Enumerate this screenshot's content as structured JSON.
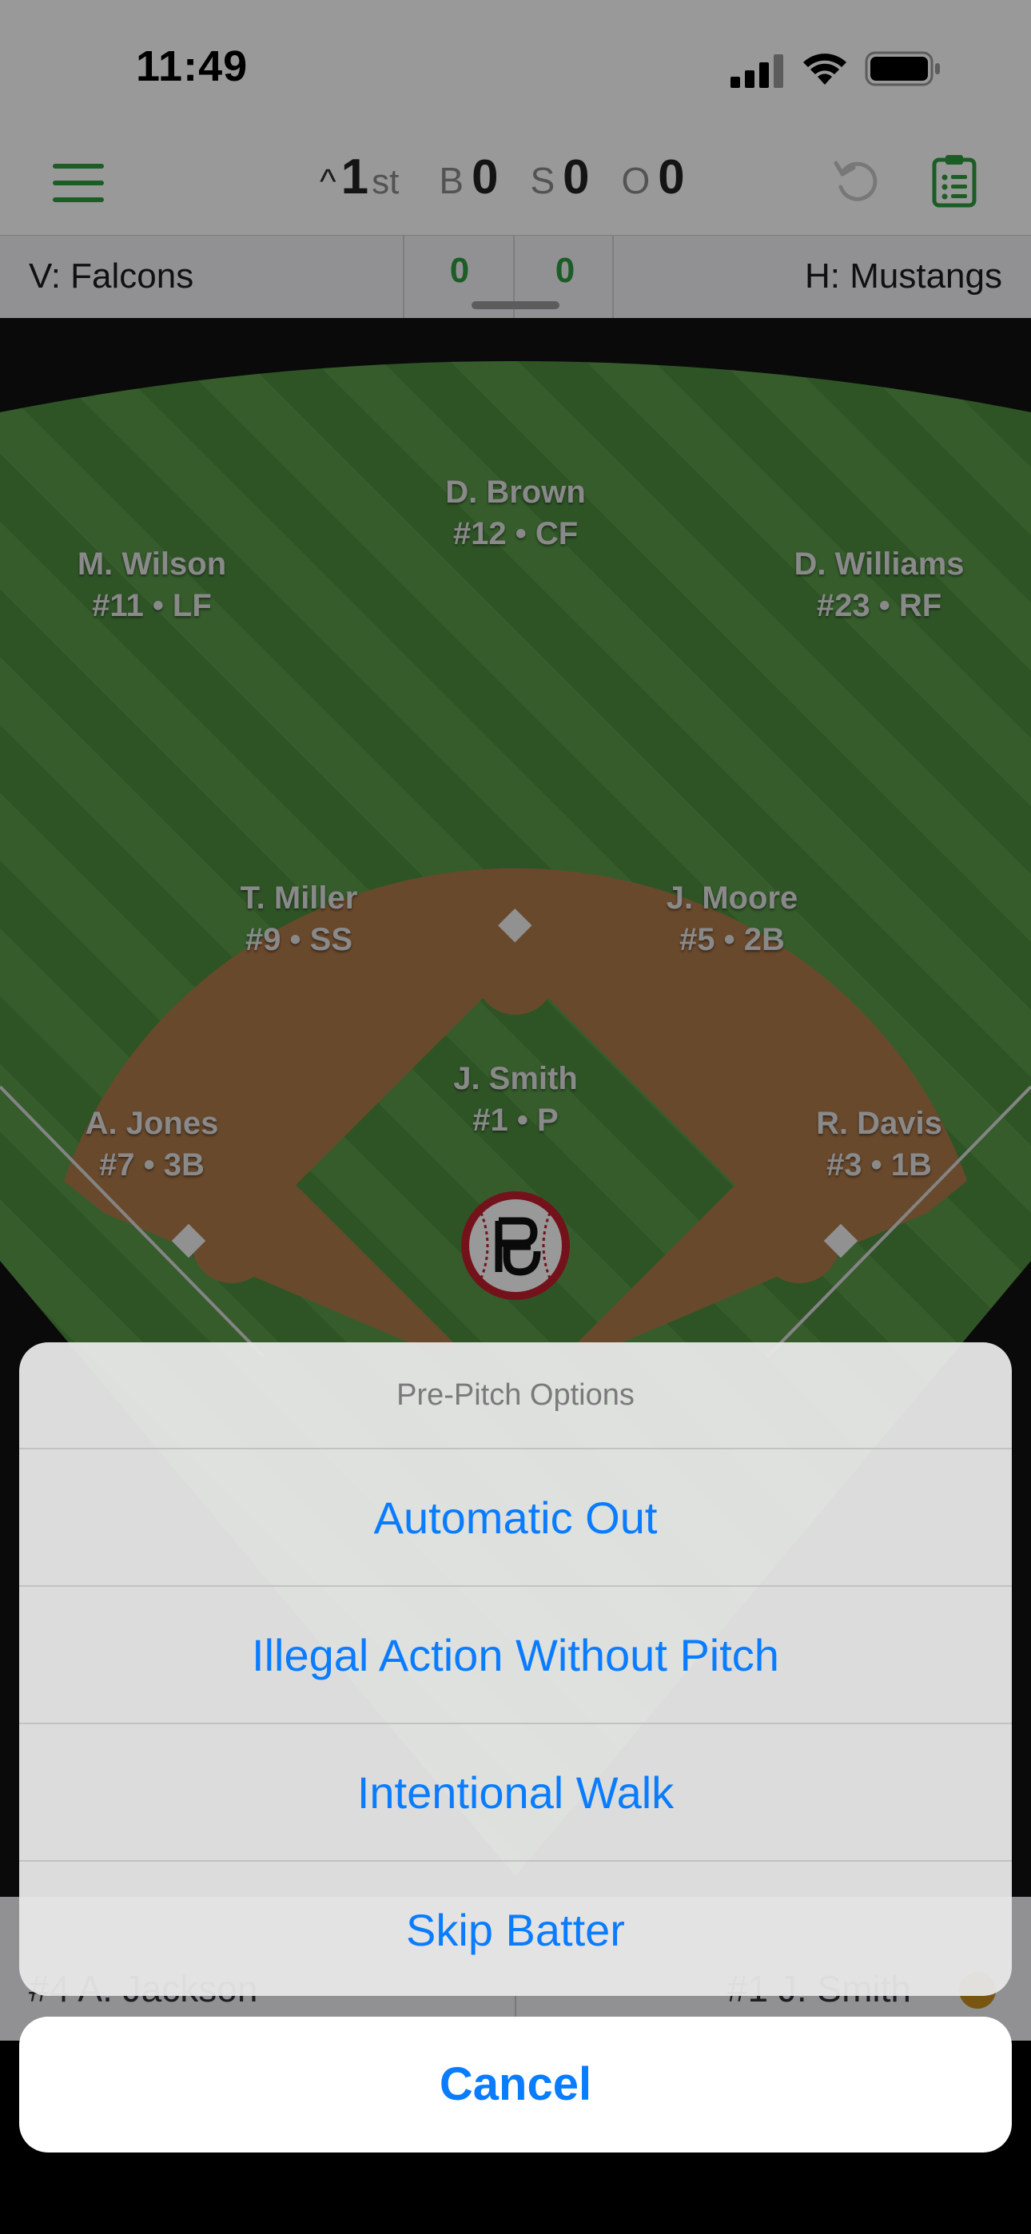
{
  "status_bar": {
    "time": "11:49",
    "signal_icon": "cellular-signal-icon",
    "wifi_icon": "wifi-icon",
    "battery_icon": "battery-icon"
  },
  "top_bar": {
    "menu_icon": "hamburger-menu-icon",
    "inning_arrow": "^",
    "inning_number": "1",
    "inning_suffix": "st",
    "balls_label": "B",
    "balls": "0",
    "strikes_label": "S",
    "strikes": "0",
    "outs_label": "O",
    "outs": "0",
    "undo_icon": "undo-icon",
    "lineup_icon": "clipboard-list-icon",
    "accent_color": "#2e9b3e"
  },
  "score_bar": {
    "visitor": "V: Falcons",
    "visitor_score": "0",
    "home_score": "0",
    "home": "H: Mustangs"
  },
  "field": {
    "players": [
      {
        "name": "D. Brown",
        "detail": "#12 • CF"
      },
      {
        "name": "M. Wilson",
        "detail": "#11 • LF"
      },
      {
        "name": "D. Williams",
        "detail": "#23 • RF"
      },
      {
        "name": "T. Miller",
        "detail": "#9 • SS"
      },
      {
        "name": "J. Moore",
        "detail": "#5 • 2B"
      },
      {
        "name": "J. Smith",
        "detail": "#1 • P"
      },
      {
        "name": "A. Jones",
        "detail": "#7 • 3B"
      },
      {
        "name": "R. Davis",
        "detail": "#3 • 1B"
      }
    ],
    "logo_icon": "pg-baseball-logo-icon"
  },
  "lineup_strip": {
    "batter": "#4 A. Jackson",
    "pitcher": "#1 J. Smith"
  },
  "action_sheet": {
    "title": "Pre-Pitch Options",
    "options": [
      "Automatic Out",
      "Illegal Action Without Pitch",
      "Intentional Walk",
      "Skip Batter"
    ],
    "cancel": "Cancel"
  }
}
